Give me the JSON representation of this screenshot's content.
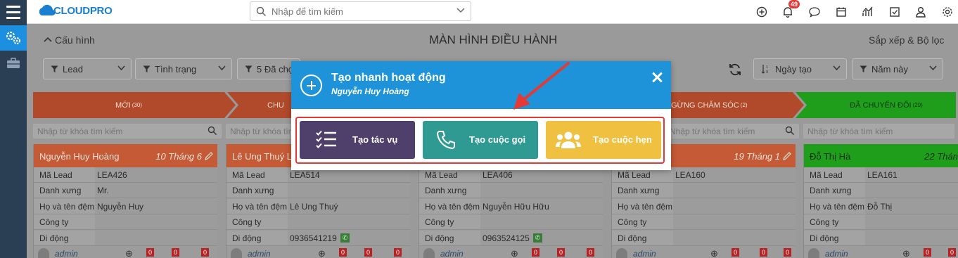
{
  "topbar": {
    "logo": "CLOUDPRO",
    "search_placeholder": "Nhập để tìm kiếm",
    "notification_count": "49"
  },
  "header": {
    "config_label": "Cấu hình",
    "page_title": "MÀN HÌNH ĐIỀU HÀNH",
    "sort_filter_label": "Sắp xếp & Bộ lọc"
  },
  "filters": {
    "lead": "Lead",
    "status": "Tình trạng",
    "selected": "5 Đã chọ",
    "sort": "Ngày tạo",
    "period": "Năm này"
  },
  "stages": [
    {
      "label": "MỚI",
      "count": "(30)"
    },
    {
      "label": "CHU",
      "count": ""
    },
    {
      "label": "GỪNG CHĂM SÓC",
      "count": "(2)"
    },
    {
      "label": "ĐÃ CHUYỂN ĐỔI",
      "count": "(29)"
    }
  ],
  "column_search_placeholder": "Nhập từ khóa tìm kiếm",
  "column_search_placeholder_short": "Nhập từ khóa tìm kiếm",
  "cards": [
    {
      "name": "Nguyễn Huy Hoàng",
      "date": "10 Tháng 6",
      "code": "LEA426",
      "salutation": "Mr.",
      "lastname": "Nguyễn Huy",
      "company": "",
      "mobile": ""
    },
    {
      "name": "Lê Ung Thuý Lê",
      "date": "",
      "code": "LEA514",
      "salutation": "",
      "lastname": "Lê Ung Thuý",
      "company": "",
      "mobile": "0936541219"
    },
    {
      "name": "",
      "date": "",
      "code": "LEA406",
      "salutation": "",
      "lastname": "Nguyễn Hữu Hữu",
      "company": "",
      "mobile": "0963524125"
    },
    {
      "name": "",
      "date": "19 Tháng 1",
      "code": "LEA160",
      "salutation": "",
      "lastname": "",
      "company": "",
      "mobile": ""
    },
    {
      "name": "Đỗ Thị Hà",
      "date": "22 Thán",
      "code": "LEA161",
      "salutation": "",
      "lastname": "Đỗ Thị",
      "company": "",
      "mobile": ""
    }
  ],
  "field_labels": {
    "code": "Mã Lead",
    "salutation": "Danh xưng",
    "lastname": "Họ và tên đệm",
    "company": "Công ty",
    "mobile": "Di động"
  },
  "card_footer": {
    "owner": "admin",
    "badge": "0"
  },
  "modal": {
    "title": "Tạo nhanh hoạt động",
    "subtitle": "Nguyễn Huy Hoàng",
    "task_label": "Tạo tác vụ",
    "call_label": "Tạo cuộc gọi",
    "meeting_label": "Tạo cuộc hẹn",
    "task_color": "#4e3f6b",
    "call_color": "#2e9a92",
    "meeting_color": "#f0c040"
  }
}
